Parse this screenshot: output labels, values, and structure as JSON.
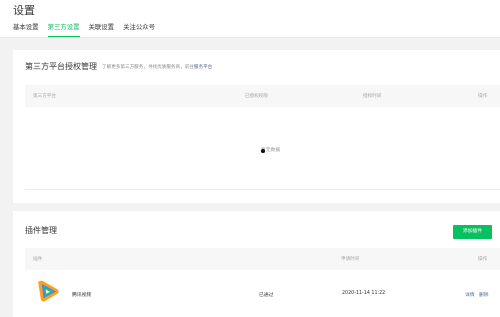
{
  "header": {
    "title": "设置",
    "tabs": [
      {
        "label": "基本设置",
        "active": false
      },
      {
        "label": "第三方设置",
        "active": true
      },
      {
        "label": "关联设置",
        "active": false
      },
      {
        "label": "关注公众号",
        "active": false
      }
    ]
  },
  "third_party": {
    "title": "第三方平台授权管理",
    "desc_prefix": "了解更多第三方服务，寻找优质服务商，前往",
    "desc_link": "服务平台",
    "columns": [
      "第三方平台",
      "已授权权限",
      "授权时间",
      "操作"
    ],
    "empty_text": "暂无数据"
  },
  "plugins": {
    "title": "插件管理",
    "add_button": "添加插件",
    "columns": [
      "插件",
      "申请时间",
      "操作"
    ],
    "rows": [
      {
        "name": "腾讯视频",
        "status": "已通过",
        "time": "2020-11-14 11:22",
        "actions": [
          "详情",
          "删除"
        ]
      }
    ]
  },
  "colors": {
    "accent": "#07c160",
    "link": "#576b95"
  }
}
